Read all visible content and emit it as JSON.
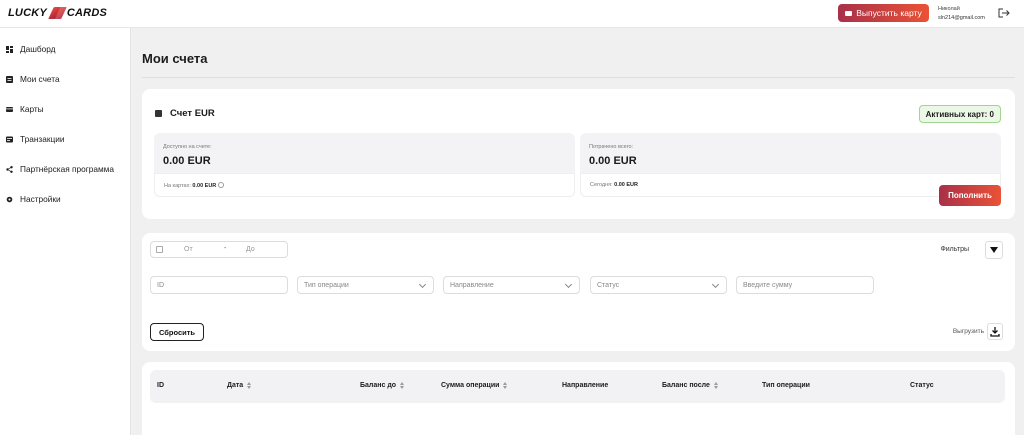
{
  "brand": {
    "left": "LUCKY",
    "right": "CARDS"
  },
  "header": {
    "issue_card_label": "Выпустить карту",
    "user_name": "Николай",
    "user_email": "sln214@gmail.com"
  },
  "sidebar": {
    "items": [
      {
        "label": "Дашборд",
        "icon": "dashboard-icon"
      },
      {
        "label": "Мои счета",
        "icon": "accounts-icon"
      },
      {
        "label": "Карты",
        "icon": "card-icon"
      },
      {
        "label": "Транзакции",
        "icon": "transactions-icon"
      },
      {
        "label": "Партнёрская программа",
        "icon": "share-icon"
      },
      {
        "label": "Настройки",
        "icon": "gear-icon"
      }
    ]
  },
  "page": {
    "title": "Мои счета"
  },
  "account": {
    "title": "Счет EUR",
    "active_cards": "Активных карт: 0",
    "available_label": "Доступно на счете:",
    "available_amount": "0.00 EUR",
    "on_cards_label": "На картах:",
    "on_cards_amount": "0.00 EUR",
    "spent_label": "Потрачено всего:",
    "spent_amount": "0.00 EUR",
    "today_label": "Сегодня:",
    "today_amount": "0.00 EUR",
    "topup_label": "Пополнить"
  },
  "filters": {
    "date_from": "От",
    "date_to": "До",
    "filters_label": "Фильтры",
    "id_placeholder": "ID",
    "op_type": "Тип операции",
    "direction": "Направление",
    "status": "Статус",
    "amount_placeholder": "Введите сумму",
    "reset_label": "Сбросить",
    "export_label": "Выгрузить"
  },
  "table": {
    "columns": [
      "ID",
      "Дата",
      "Баланс до",
      "Сумма операции",
      "Направление",
      "Баланс после",
      "Тип операции",
      "Статус"
    ]
  }
}
